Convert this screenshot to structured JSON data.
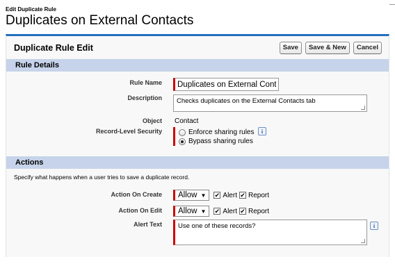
{
  "header": {
    "kicker": "Edit Duplicate Rule",
    "title": "Duplicates on External Contacts"
  },
  "panel": {
    "title": "Duplicate Rule Edit",
    "buttons": {
      "save": "Save",
      "save_new": "Save & New",
      "cancel": "Cancel"
    }
  },
  "rule_details": {
    "section_title": "Rule Details",
    "rule_name": {
      "label": "Rule Name",
      "value": "Duplicates on External Conta"
    },
    "description": {
      "label": "Description",
      "value": "Checks duplicates on the External Contacts tab"
    },
    "object": {
      "label": "Object",
      "value": "Contact"
    },
    "security": {
      "label": "Record-Level Security",
      "options": [
        {
          "label": "Enforce sharing rules",
          "selected": false
        },
        {
          "label": "Bypass sharing rules",
          "selected": true
        }
      ]
    }
  },
  "actions": {
    "section_title": "Actions",
    "hint": "Specify what happens when a user tries to save a duplicate record.",
    "on_create": {
      "label": "Action On Create",
      "select": "Allow",
      "alert_label": "Alert",
      "alert": true,
      "report_label": "Report",
      "report": true
    },
    "on_edit": {
      "label": "Action On Edit",
      "select": "Allow",
      "alert_label": "Alert",
      "alert": true,
      "report_label": "Report",
      "report": true
    },
    "alert_text": {
      "label": "Alert Text",
      "value": "Use one of these records?"
    }
  },
  "icons": {
    "info": "i",
    "caret": "▼",
    "check": "✔"
  },
  "colors": {
    "accent": "#236fbd",
    "section": "#c6d3ea",
    "required": "#cc0000"
  }
}
